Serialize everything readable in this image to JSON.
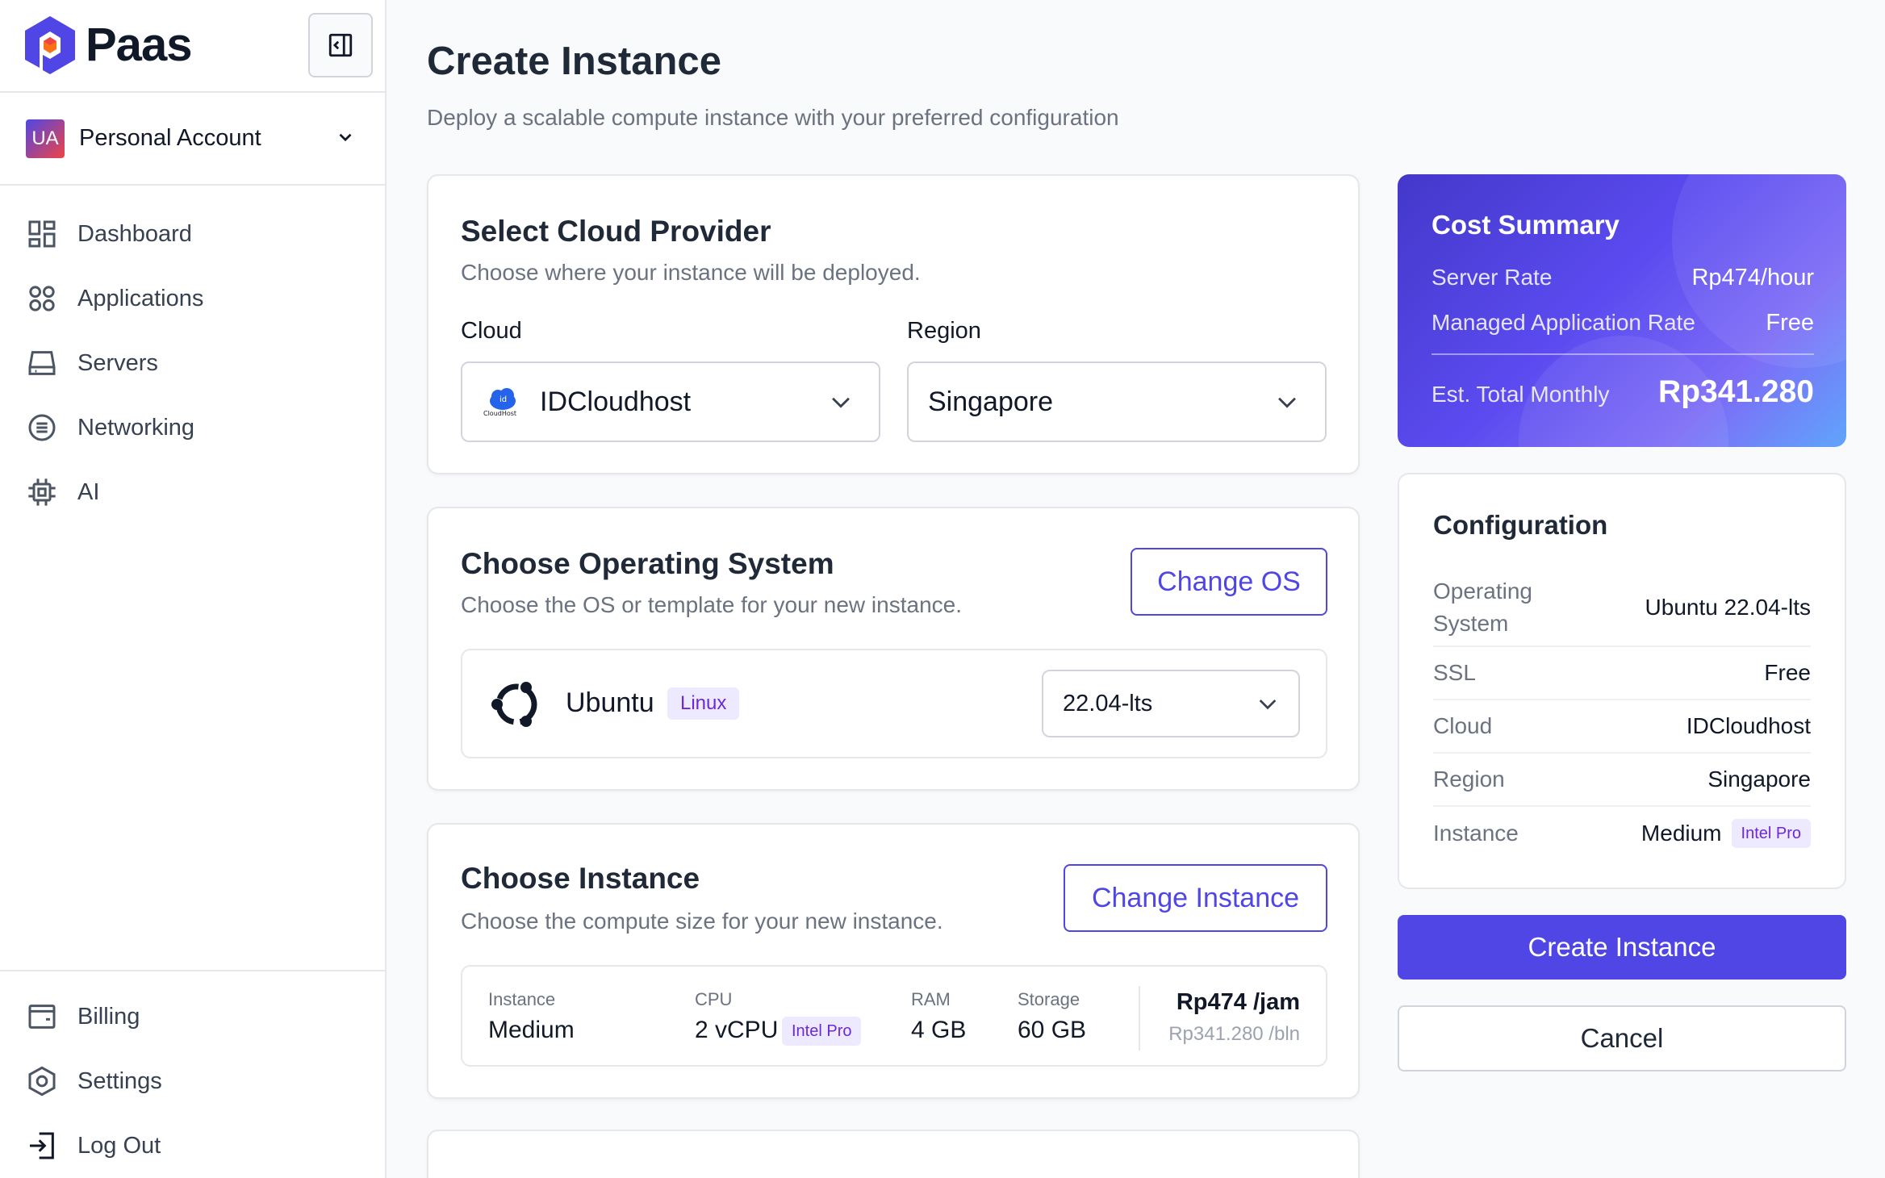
{
  "brand": {
    "name": "Paas"
  },
  "account": {
    "initials": "UA",
    "name": "Personal Account"
  },
  "nav": {
    "items": [
      {
        "label": "Dashboard",
        "icon": "grid-icon"
      },
      {
        "label": "Applications",
        "icon": "apps-icon"
      },
      {
        "label": "Servers",
        "icon": "server-icon"
      },
      {
        "label": "Networking",
        "icon": "network-icon"
      },
      {
        "label": "AI",
        "icon": "chip-icon"
      }
    ],
    "bottom": [
      {
        "label": "Billing",
        "icon": "wallet-icon"
      },
      {
        "label": "Settings",
        "icon": "settings-icon"
      },
      {
        "label": "Log Out",
        "icon": "logout-icon"
      }
    ]
  },
  "page": {
    "title": "Create Instance",
    "subtitle": "Deploy a scalable compute instance with your preferred configuration"
  },
  "provider": {
    "title": "Select Cloud Provider",
    "subtitle": "Choose where your instance will be deployed.",
    "cloud_label": "Cloud",
    "cloud_value": "IDCloudhost",
    "cloud_logo_text": "CloudHost",
    "cloud_logo_mark": "id",
    "region_label": "Region",
    "region_value": "Singapore"
  },
  "os": {
    "title": "Choose Operating System",
    "subtitle": "Choose the OS or template for your new instance.",
    "change_label": "Change OS",
    "name": "Ubuntu",
    "badge": "Linux",
    "version": "22.04-lts"
  },
  "instance": {
    "title": "Choose Instance",
    "subtitle": "Choose the compute size for your new instance.",
    "change_label": "Change Instance",
    "instance_label": "Instance",
    "instance_value": "Medium",
    "cpu_label": "CPU",
    "cpu_value": "2 vCPU",
    "cpu_badge": "Intel Pro",
    "ram_label": "RAM",
    "ram_value": "4 GB",
    "storage_label": "Storage",
    "storage_value": "60 GB",
    "price_hourly": "Rp474 /jam",
    "price_monthly": "Rp341.280 /bln"
  },
  "cost_summary": {
    "title": "Cost Summary",
    "server_rate_label": "Server Rate",
    "server_rate_value": "Rp474/hour",
    "managed_label": "Managed Application Rate",
    "managed_value": "Free",
    "total_label": "Est. Total Monthly",
    "total_value": "Rp341.280"
  },
  "configuration": {
    "title": "Configuration",
    "rows": [
      {
        "label": "Operating System",
        "value": "Ubuntu 22.04-lts"
      },
      {
        "label": "SSL",
        "value": "Free"
      },
      {
        "label": "Cloud",
        "value": "IDCloudhost"
      },
      {
        "label": "Region",
        "value": "Singapore"
      },
      {
        "label": "Instance",
        "value": "Medium",
        "badge": "Intel Pro"
      }
    ]
  },
  "actions": {
    "create_label": "Create Instance",
    "cancel_label": "Cancel"
  },
  "colors": {
    "accent": "#4f46e5",
    "badge_bg": "#ede9fe",
    "badge_text": "#6d28d9"
  }
}
